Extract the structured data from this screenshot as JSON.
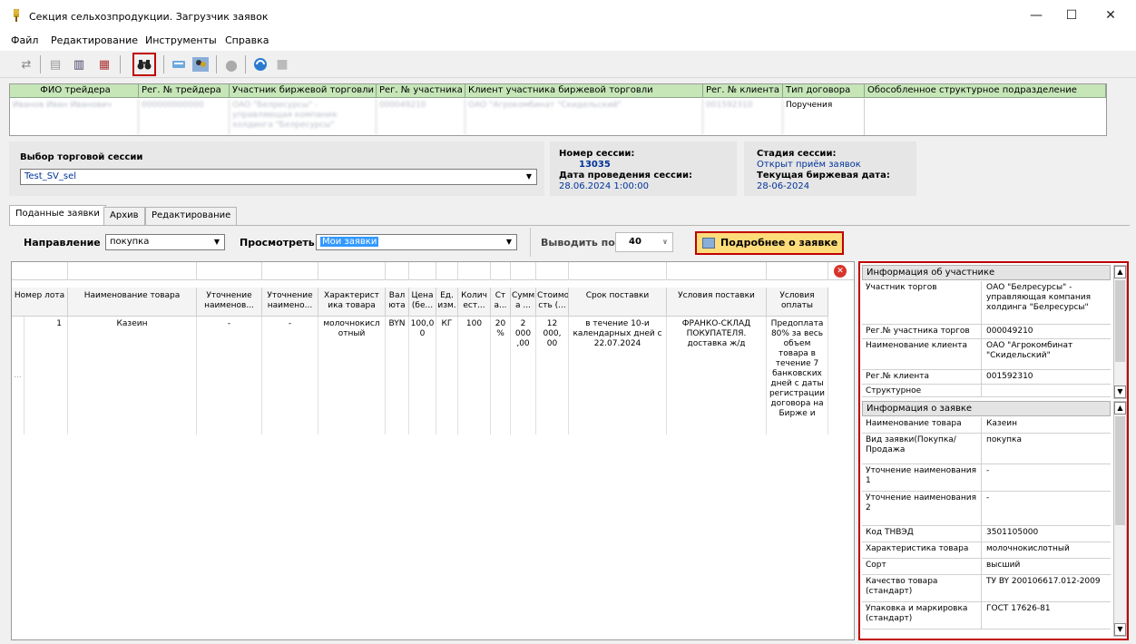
{
  "window": {
    "title": "Секция сельхозпродукции. Загрузчик заявок",
    "controls": {
      "minimize": "—",
      "maximize": "☐",
      "close": "✕"
    }
  },
  "menu": [
    "Файл",
    "Редактирование",
    "Инструменты",
    "Справка"
  ],
  "trader_grid": {
    "headers": [
      "ФИО трейдера",
      "Рег. № трейдера",
      "Участник биржевой торговли",
      "Рег. № участника",
      "Клиент участника биржевой торговли",
      "Рег. № клиента",
      "Тип договора",
      "Обособленное структурное подразделение"
    ],
    "row": [
      "Иванов Иван Иванович",
      "000000000000",
      "ОАО \"Белресурсы\" - управляющая компания холдинга \"Белресурсы\"",
      "000049210",
      "ОАО \"Агрокомбинат \"Скидельский\"",
      "001592310",
      "Поручения",
      ""
    ]
  },
  "session": {
    "select_label": "Выбор торговой сессии",
    "select_value": "Test_SV_sel",
    "number_label": "Номер сессии:",
    "number_value": "13035",
    "date_label": "Дата проведения сессии:",
    "date_value": "28.06.2024 1:00:00",
    "stage_label": "Стадия сессии:",
    "stage_value": "Открыт приём заявок",
    "current_date_label": "Текущая биржевая дата:",
    "current_date_value": "28-06-2024"
  },
  "tabs": [
    "Поданные заявки",
    "Архив",
    "Редактирование"
  ],
  "filters": {
    "direction_label": "Направление",
    "direction_value": "покупка",
    "view_label": "Просмотреть",
    "view_value": "Мои заявки",
    "page_label": "Выводить по",
    "page_value": "40",
    "detail_button": "Подробнее о заявке"
  },
  "orders_grid": {
    "headers": [
      "Номер лота",
      "Наименование товара",
      "Уточнение наименов...",
      "Уточнение наимено...",
      "Характерист ика товара",
      "Вал юта",
      "Цена (бе...",
      "Ед. изм.",
      "Колич ест...",
      "Ст а...",
      "Сумм а ...",
      "Стоимо сть (...",
      "Срок поставки",
      "Условия поставки",
      "Условия оплаты"
    ],
    "row": [
      "1",
      "Казеин",
      "-",
      "-",
      "молочнокисл отный",
      "BYN",
      "100,0 0",
      "КГ",
      "100",
      "20 %",
      "2 000 ,00",
      "12 000, 00",
      "в течение 10-и календарных дней с 22.07.2024",
      "ФРАНКО-СКЛАД ПОКУПАТЕЛЯ. доставка ж/д",
      "Предоплата 80% за весь объем товара в течение 7 банковских дней с даты регистрации договора на Бирже и"
    ],
    "row_indicator": "..."
  },
  "participant_info": {
    "title": "Информация об участнике",
    "rows": [
      {
        "k": "Участник торгов",
        "v": "ОАО \"Белресурсы\" - управляющая компания холдинга \"Белресурсы\""
      },
      {
        "k": "Рег.№ участника торгов",
        "v": "000049210"
      },
      {
        "k": "Наименование клиента",
        "v": "ОАО \"Агрокомбинат \"Скидельский\""
      },
      {
        "k": "Рег.№ клиента",
        "v": "001592310"
      },
      {
        "k": "Структурное",
        "v": ""
      }
    ]
  },
  "order_info": {
    "title": "Информация о заявке",
    "rows": [
      {
        "k": "Наименование товара",
        "v": "Казеин"
      },
      {
        "k": "Вид заявки(Покупка/Продажа",
        "v": "покупка"
      },
      {
        "k": "Уточнение наименования 1",
        "v": "-"
      },
      {
        "k": "Уточнение наименования 2",
        "v": "-"
      },
      {
        "k": "Код ТНВЭД",
        "v": "3501105000"
      },
      {
        "k": "Характеристика товара",
        "v": "молочнокислотный"
      },
      {
        "k": "Сорт",
        "v": "высший"
      },
      {
        "k": "Качество товара (стандарт)",
        "v": "ТУ BY 200106617.012-2009"
      },
      {
        "k": "Упаковка и маркировка (стандарт)",
        "v": "ГОСТ 17626-81"
      }
    ]
  },
  "colors": {
    "accent_red": "#c00000",
    "header_green": "#c6e6b8",
    "button_yellow": "#ffdc7a",
    "link_blue": "#003399"
  }
}
